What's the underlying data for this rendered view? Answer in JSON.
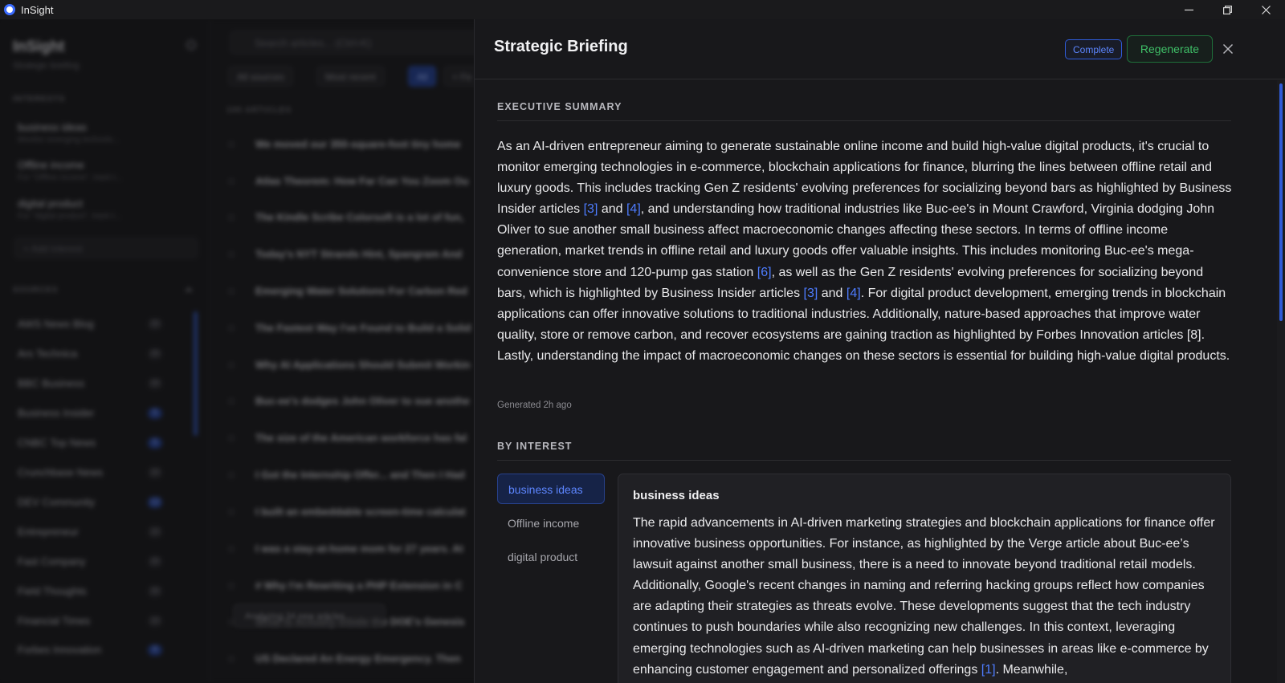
{
  "window": {
    "title": "InSight"
  },
  "sidebar": {
    "brand": "InSight",
    "brand_sub": "Strategic briefing",
    "interests_label": "INTERESTS",
    "interests": [
      {
        "name": "business ideas",
        "desc": "Monitor emerging technolo..."
      },
      {
        "name": "Offline income",
        "desc": "For \"Offline income\", track t..."
      },
      {
        "name": "digital product",
        "desc": "For \"digital product\", track t..."
      }
    ],
    "add_interest": "+ Add interest",
    "sources_label": "SOURCES",
    "sources": [
      {
        "name": "AWS News Blog",
        "count": "20",
        "blue": false
      },
      {
        "name": "Ars Technica",
        "count": "20",
        "blue": false
      },
      {
        "name": "BBC Business",
        "count": "20",
        "blue": false
      },
      {
        "name": "Business Insider",
        "count": "5",
        "blue": true
      },
      {
        "name": "CNBC Top News",
        "count": "5",
        "blue": true
      },
      {
        "name": "Crunchbase News",
        "count": "10",
        "blue": false
      },
      {
        "name": "DEV Community",
        "count": "12",
        "blue": true
      },
      {
        "name": "Entrepreneur",
        "count": "10",
        "blue": false
      },
      {
        "name": "Fast Company",
        "count": "20",
        "blue": false
      },
      {
        "name": "Field Thoughts",
        "count": "20",
        "blue": false
      },
      {
        "name": "Financial Times",
        "count": "10",
        "blue": false
      },
      {
        "name": "Forbes Innovation",
        "count": "8",
        "blue": true
      }
    ]
  },
  "list": {
    "search_placeholder": "Search articles... (Ctrl+K)",
    "filters": [
      "All sources",
      "Most recent",
      "All",
      "+ Fe"
    ],
    "header": "100 ARTICLES",
    "articles": [
      "We moved our 350-square-foot tiny home",
      "Atlas Theorem: How Far Can You Zoom Ou",
      "The Kindle Scribe Colorsoft is a lot of fun,",
      "Today's NYT Strands Hint, Spangram And",
      "Emerging Water Solutions For Carbon Red",
      "The Fastest Way I've Found to Build a Solid",
      "Why AI Applications Should Submit Workin",
      "Buc-ee's dodges John Oliver to sue anothe",
      "The size of the American workforce has fal",
      "I Got the Internship Offer... and Then I Had",
      "I built an embeddable screen-time calculat",
      "I was a stay-at-home mom for 27 years. At",
      "# Why I'm Rewriting a PHP Extension in C",
      "What Is Actually Inside the DOE's Genesis",
      "US Declared An Energy Emergency. Then"
    ],
    "analyzing": "Analyzing 34 new articles..."
  },
  "briefing": {
    "title": "Strategic Briefing",
    "status": "Complete",
    "regenerate": "Regenerate",
    "executive_label": "EXECUTIVE SUMMARY",
    "summary": {
      "p1": "As an AI-driven entrepreneur aiming to generate sustainable online income and build high-value digital products, it's crucial to monitor emerging technologies in e-commerce, blockchain applications for finance, blurring the lines between offline retail and luxury goods. This includes tracking Gen Z residents' evolving preferences for socializing beyond bars as highlighted by Business Insider articles ",
      "c1": "[3]",
      "and1": " and ",
      "c2": "[4]",
      "p2": ", and understanding how traditional industries like Buc-ee's in Mount Crawford, Virginia dodging John Oliver to sue another small business affect macroeconomic changes affecting these sectors. In terms of offline income generation, market trends in offline retail and luxury goods offer valuable insights. This includes monitoring Buc-ee's mega-convenience store and 120-pump gas station ",
      "c3": "[6]",
      "p3": ", as well as the Gen Z residents' evolving preferences for socializing beyond bars, which is highlighted by Business Insider articles ",
      "c4": "[3]",
      "and2": " and ",
      "c5": "[4]",
      "p4": ". For digital product development, emerging trends in blockchain applications can offer innovative solutions to traditional industries. Additionally, nature-based approaches that improve water quality, store or remove carbon, and recover ecosystems are gaining traction as highlighted by Forbes Innovation articles [8]. Lastly, understanding the impact of macroeconomic changes on these sectors is essential for building high-value digital products."
    },
    "generated": "Generated 2h ago",
    "by_interest_label": "BY INTEREST",
    "interest_tabs": [
      "business ideas",
      "Offline income",
      "digital product"
    ],
    "active_interest": {
      "title": "business ideas",
      "text": "The rapid advancements in AI-driven marketing strategies and blockchain applications for finance offer innovative business opportunities. For instance, as highlighted by the Verge article about Buc-ee’s lawsuit against another small business, there is a need to innovate beyond traditional retail models. Additionally, Google's recent changes in naming and referring hacking groups reflect how companies are adapting their strategies as threats evolve. These developments suggest that the tech industry continues to push boundaries while also recognizing new challenges. In this context, leveraging emerging technologies such as AI-driven marketing can help businesses in areas like e-commerce by enhancing customer engagement and personalized offerings ",
      "cite": "[1]",
      "tail": ". Meanwhile,"
    }
  },
  "colors": {
    "accent": "#4d7cff",
    "success": "#3fbf67",
    "panel_bg": "#18181b"
  },
  "icons": {
    "app": "insight-logo-icon",
    "close": "close-icon",
    "minimize": "minimize-icon",
    "restore": "restore-icon"
  }
}
